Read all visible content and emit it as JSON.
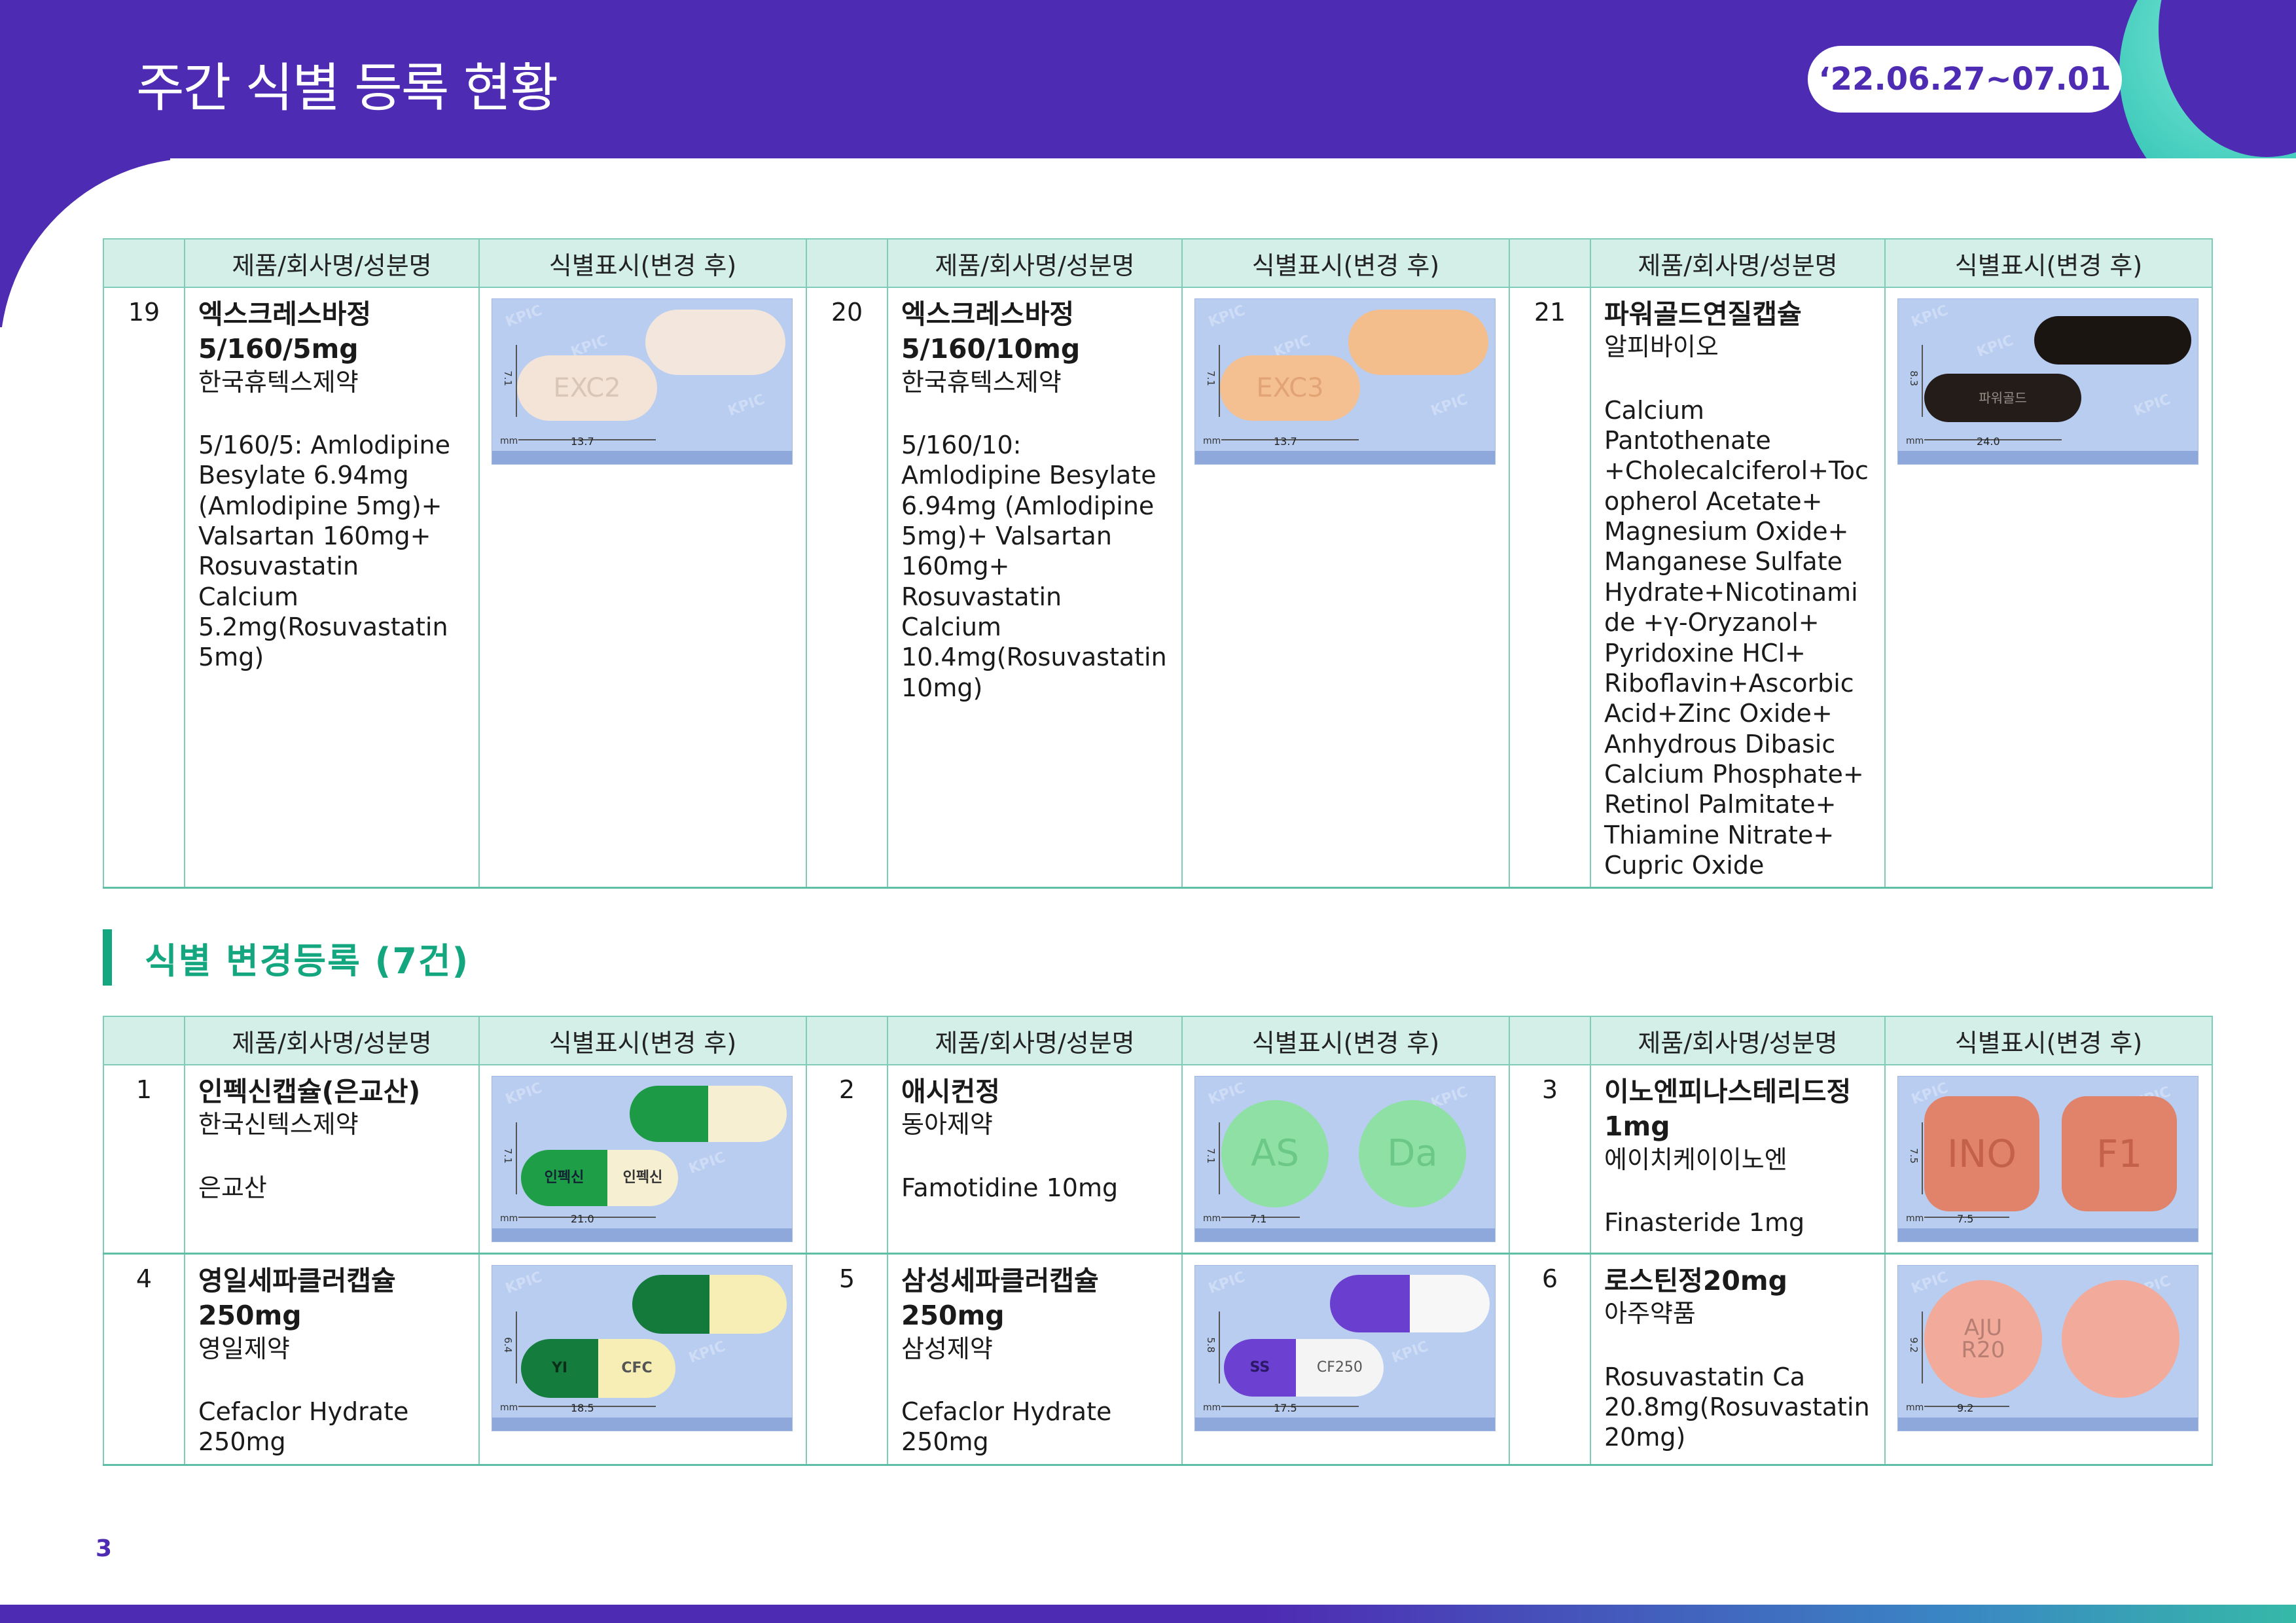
{
  "header": {
    "title": "주간 식별 등록 현황",
    "date_range": "‘22.06.27~07.01"
  },
  "colors": {
    "brand_purple": "#4e2bb3",
    "accent_green": "#14a77f",
    "table_header_bg": "#d3efe7"
  },
  "columns": {
    "product": "제품/회사명/성분명",
    "identification": "식별표시(변경 후)"
  },
  "table1": {
    "items": [
      {
        "no": "19",
        "name": "엑스크레스바정 5/160/5mg",
        "company": "한국휴텍스제약",
        "ingredient": "5/160/5: Amlodipine Besylate 6.94mg (Amlodipine 5mg)+ Valsartan 160mg+ Rosuvastatin Calcium 5.2mg(Rosuvastatin 5mg)",
        "photo": {
          "imprint_front": "EXC2",
          "imprint_back": "",
          "height_label": "7.1",
          "length_label": "13.7",
          "unit": "mm"
        }
      },
      {
        "no": "20",
        "name": "엑스크레스바정 5/160/10mg",
        "company": "한국휴텍스제약",
        "ingredient": "5/160/10: Amlodipine Besylate 6.94mg (Amlodipine 5mg)+ Valsartan 160mg+ Rosuvastatin Calcium 10.4mg(Rosuvastatin 10mg)",
        "photo": {
          "imprint_front": "EXC3",
          "imprint_back": "",
          "height_label": "7.1",
          "length_label": "13.7",
          "unit": "mm"
        }
      },
      {
        "no": "21",
        "name": "파워골드연질캡슐",
        "company": "알피바이오",
        "ingredient": "Calcium Pantothenate +Cholecalciferol+Tocopherol Acetate+ Magnesium Oxide+ Manganese Sulfate Hydrate+Nicotinamide +γ-Oryzanol+ Pyridoxine HCl+ Riboflavin+Ascorbic Acid+Zinc Oxide+ Anhydrous Dibasic Calcium Phosphate+ Retinol Palmitate+ Thiamine Nitrate+ Cupric Oxide",
        "photo": {
          "imprint_front": "파워골드",
          "imprint_back": "",
          "height_label": "8.3",
          "length_label": "24.0",
          "unit": "mm"
        }
      }
    ]
  },
  "section2": {
    "title": "식별 변경등록 (7건)"
  },
  "table2": {
    "items": [
      {
        "no": "1",
        "name": "인펙신캡슐(은교산)",
        "company": "한국신텍스제약",
        "ingredient": "은교산",
        "photo": {
          "imprint_front": "인펙신",
          "imprint_back": "인펙신",
          "height_label": "7.1",
          "length_label": "21.0",
          "unit": "mm"
        }
      },
      {
        "no": "2",
        "name": "애시컨정",
        "company": "동아제약",
        "ingredient": "Famotidine 10mg",
        "photo": {
          "imprint_front": "AS",
          "imprint_back": "Da",
          "height_label": "7.1",
          "length_label": "7.1",
          "unit": "mm"
        }
      },
      {
        "no": "3",
        "name": "이노엔피나스테리드정 1mg",
        "company": "에이치케이이노엔",
        "ingredient": "Finasteride 1mg",
        "photo": {
          "imprint_front": "INO",
          "imprint_back": "F1",
          "height_label": "7.5",
          "length_label": "7.5",
          "unit": "mm"
        }
      },
      {
        "no": "4",
        "name": "영일세파클러캡슐 250mg",
        "company": "영일제약",
        "ingredient": "Cefaclor Hydrate 250mg",
        "photo": {
          "imprint_front": "YI",
          "imprint_back": "CFC",
          "height_label": "6.4",
          "length_label": "18.5",
          "unit": "mm"
        }
      },
      {
        "no": "5",
        "name": "삼성세파클러캡슐 250mg",
        "company": "삼성제약",
        "ingredient": "Cefaclor Hydrate 250mg",
        "photo": {
          "imprint_front": "SS",
          "imprint_back": "CF250",
          "height_label": "5.8",
          "length_label": "17.5",
          "unit": "mm"
        }
      },
      {
        "no": "6",
        "name": "로스틴정20mg",
        "company": "아주약품",
        "ingredient": "Rosuvastatin Ca 20.8mg(Rosuvastatin 20mg)",
        "photo": {
          "imprint_front": "AJU R20",
          "imprint_back": "",
          "height_label": "9.2",
          "length_label": "9.2",
          "unit": "mm"
        }
      }
    ]
  },
  "page_number": "3"
}
